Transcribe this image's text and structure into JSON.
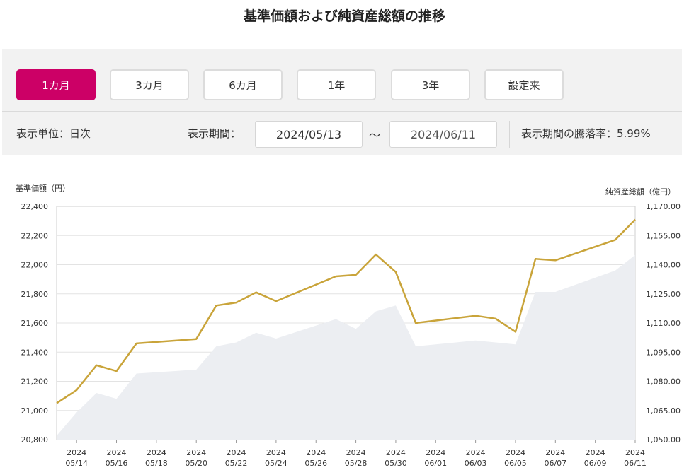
{
  "title": "基準価額および純資産総額の推移",
  "periods": [
    "1カ月",
    "3カ月",
    "6カ月",
    "1年",
    "3年",
    "設定来"
  ],
  "active_period_index": 0,
  "display_unit": "表示単位：日次",
  "display_period_label": "表示期間：",
  "start_date": "2024/05/13",
  "end_date": "2024/06/11",
  "tilde": "～",
  "change_rate_text": "表示期間の騰落率：5.99%",
  "colors": {
    "accent": "#cc0066",
    "nav_line": "#c9a43a",
    "aum_area": "#eceef2"
  },
  "chart_data": {
    "type": "line",
    "left_axis_title": "基準価額（円）",
    "right_axis_title": "純資産総額（億円）",
    "y_left": {
      "min": 20800,
      "max": 22400,
      "ticks": [
        "20,800",
        "21,000",
        "21,200",
        "21,400",
        "21,600",
        "21,800",
        "22,000",
        "22,200",
        "22,400"
      ]
    },
    "y_right": {
      "min": 1050,
      "max": 1170,
      "ticks": [
        "1,050.00",
        "1,065.00",
        "1,080.00",
        "1,095.00",
        "1,110.00",
        "1,125.00",
        "1,140.00",
        "1,155.00",
        "1,170.00"
      ]
    },
    "x_ticks": [
      [
        "2024",
        "05/14"
      ],
      [
        "2024",
        "05/16"
      ],
      [
        "2024",
        "05/18"
      ],
      [
        "2024",
        "05/20"
      ],
      [
        "2024",
        "05/22"
      ],
      [
        "2024",
        "05/24"
      ],
      [
        "2024",
        "05/26"
      ],
      [
        "2024",
        "05/28"
      ],
      [
        "2024",
        "05/30"
      ],
      [
        "2024",
        "06/01"
      ],
      [
        "2024",
        "06/03"
      ],
      [
        "2024",
        "06/05"
      ],
      [
        "2024",
        "06/07"
      ],
      [
        "2024",
        "06/09"
      ],
      [
        "2024",
        "06/11"
      ]
    ],
    "x_range": [
      "2024-05-13",
      "2024-06-11"
    ],
    "nav_series": [
      {
        "x": "2024-05-13",
        "y": 21050
      },
      {
        "x": "2024-05-14",
        "y": 21140
      },
      {
        "x": "2024-05-15",
        "y": 21310
      },
      {
        "x": "2024-05-16",
        "y": 21270
      },
      {
        "x": "2024-05-17",
        "y": 21460
      },
      {
        "x": "2024-05-20",
        "y": 21490
      },
      {
        "x": "2024-05-21",
        "y": 21720
      },
      {
        "x": "2024-05-22",
        "y": 21740
      },
      {
        "x": "2024-05-23",
        "y": 21810
      },
      {
        "x": "2024-05-24",
        "y": 21750
      },
      {
        "x": "2024-05-27",
        "y": 21920
      },
      {
        "x": "2024-05-28",
        "y": 21930
      },
      {
        "x": "2024-05-29",
        "y": 22070
      },
      {
        "x": "2024-05-30",
        "y": 21950
      },
      {
        "x": "2024-05-31",
        "y": 21600
      },
      {
        "x": "2024-06-03",
        "y": 21650
      },
      {
        "x": "2024-06-04",
        "y": 21630
      },
      {
        "x": "2024-06-05",
        "y": 21540
      },
      {
        "x": "2024-06-06",
        "y": 22040
      },
      {
        "x": "2024-06-07",
        "y": 22030
      },
      {
        "x": "2024-06-10",
        "y": 22170
      },
      {
        "x": "2024-06-11",
        "y": 22310
      }
    ],
    "aum_series": [
      {
        "x": "2024-05-13",
        "y": 1052
      },
      {
        "x": "2024-05-14",
        "y": 1064
      },
      {
        "x": "2024-05-15",
        "y": 1074
      },
      {
        "x": "2024-05-16",
        "y": 1071
      },
      {
        "x": "2024-05-17",
        "y": 1084
      },
      {
        "x": "2024-05-20",
        "y": 1086
      },
      {
        "x": "2024-05-21",
        "y": 1098
      },
      {
        "x": "2024-05-22",
        "y": 1100
      },
      {
        "x": "2024-05-23",
        "y": 1105
      },
      {
        "x": "2024-05-24",
        "y": 1102
      },
      {
        "x": "2024-05-27",
        "y": 1112
      },
      {
        "x": "2024-05-28",
        "y": 1107
      },
      {
        "x": "2024-05-29",
        "y": 1116
      },
      {
        "x": "2024-05-30",
        "y": 1119
      },
      {
        "x": "2024-05-31",
        "y": 1098
      },
      {
        "x": "2024-06-03",
        "y": 1101
      },
      {
        "x": "2024-06-04",
        "y": 1100
      },
      {
        "x": "2024-06-05",
        "y": 1099
      },
      {
        "x": "2024-06-06",
        "y": 1126
      },
      {
        "x": "2024-06-07",
        "y": 1126
      },
      {
        "x": "2024-06-10",
        "y": 1137
      },
      {
        "x": "2024-06-11",
        "y": 1145
      }
    ],
    "grid": true
  }
}
